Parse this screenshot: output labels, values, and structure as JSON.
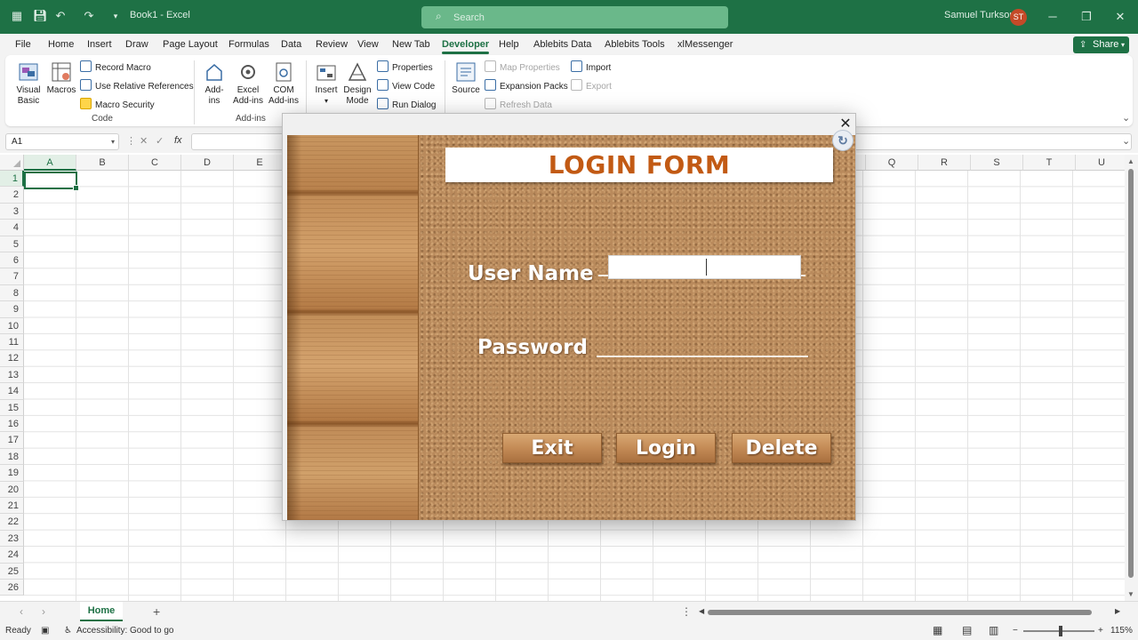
{
  "titlebar": {
    "doc_title": "Book1 - Excel",
    "search_placeholder": "Search",
    "user_name": "Samuel Turkson",
    "user_initials": "ST"
  },
  "menu": {
    "tabs": [
      "File",
      "Home",
      "Insert",
      "Draw",
      "Page Layout",
      "Formulas",
      "Data",
      "Review",
      "View",
      "New Tab",
      "Developer",
      "Help",
      "Ablebits Data",
      "Ablebits Tools",
      "xlMessenger"
    ],
    "active_tab": "Developer",
    "share_label": "Share"
  },
  "ribbon": {
    "code": {
      "visual_basic": "Visual Basic",
      "macros": "Macros",
      "record_macro": "Record Macro",
      "relative_refs": "Use Relative References",
      "macro_security": "Macro Security",
      "label": "Code"
    },
    "addins": {
      "addins": "Add-ins",
      "excel_addins": "Excel Add-ins",
      "com_addins": "COM Add-ins",
      "label": "Add-ins"
    },
    "controls": {
      "insert": "Insert",
      "design_mode": "Design Mode",
      "properties": "Properties",
      "view_code": "View Code",
      "run_dialog": "Run Dialog"
    },
    "xml": {
      "source": "Source",
      "map_properties": "Map Properties",
      "expansion_packs": "Expansion Packs",
      "refresh_data": "Refresh Data",
      "import": "Import",
      "export": "Export"
    }
  },
  "formula_bar": {
    "name_box": "A1",
    "fx": "fx",
    "value": ""
  },
  "grid": {
    "columns_left": [
      "A",
      "B",
      "C",
      "D",
      "E"
    ],
    "columns_right": [
      "Q",
      "R",
      "S",
      "T",
      "U"
    ],
    "rows": [
      "1",
      "2",
      "3",
      "4",
      "5",
      "6",
      "7",
      "8",
      "9",
      "10",
      "11",
      "12",
      "13",
      "14",
      "15",
      "16",
      "17",
      "18",
      "19",
      "20",
      "21",
      "22",
      "23",
      "24",
      "25",
      "26"
    ],
    "active_cell": "A1"
  },
  "sheets": {
    "tabs": [
      "Home"
    ],
    "active": "Home"
  },
  "status": {
    "mode": "Ready",
    "accessibility": "Accessibility: Good to go",
    "zoom": "115%"
  },
  "login_form": {
    "title": "LOGIN FORM",
    "username_label": "User Name",
    "password_label": "Password",
    "username_value": "",
    "password_value": "",
    "buttons": {
      "exit": "Exit",
      "login": "Login",
      "delete": "Delete"
    },
    "close_symbol": "✕"
  },
  "colors": {
    "excel_green": "#1e7145",
    "title_orange": "#c25a14",
    "cork": "#b98a5c"
  }
}
